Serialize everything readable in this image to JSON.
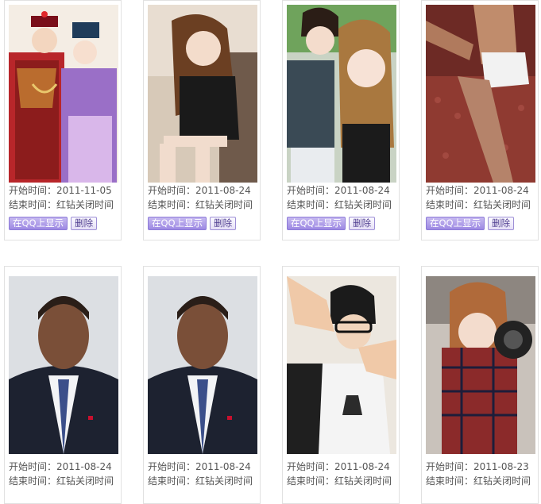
{
  "labels": {
    "start": "开始时间：",
    "end": "结束时间：",
    "show_in_qq": "在QQ上显示",
    "delete": "删除"
  },
  "items": [
    {
      "start_date": "2011-11-05",
      "end_text": "红钻关闭时间",
      "photo": "qing-dynasty-couple-illustration"
    },
    {
      "start_date": "2011-08-24",
      "end_text": "红钻关闭时间",
      "photo": "girl-long-hair-sofa"
    },
    {
      "start_date": "2011-08-24",
      "end_text": "红钻关闭时间",
      "photo": "boy-and-girl-selfie"
    },
    {
      "start_date": "2011-08-24",
      "end_text": "红钻关闭时间",
      "photo": "man-on-red-sofa"
    },
    {
      "start_date": "2011-08-24",
      "end_text": "红钻关闭时间",
      "photo": "man-in-suit-portrait"
    },
    {
      "start_date": "2011-08-24",
      "end_text": "红钻关闭时间",
      "photo": "man-in-suit-portrait"
    },
    {
      "start_date": "2011-08-24",
      "end_text": "红钻关闭时间",
      "photo": "boy-glasses-hand-frame"
    },
    {
      "start_date": "2011-08-23",
      "end_text": "红钻关闭时间",
      "photo": "girl-plaid-shirt-camera"
    }
  ]
}
